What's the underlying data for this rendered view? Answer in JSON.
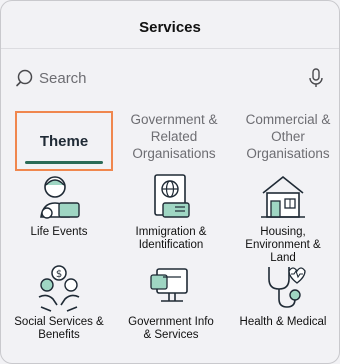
{
  "header": {
    "title": "Services"
  },
  "search": {
    "placeholder": "Search"
  },
  "tabs": [
    {
      "label": "Theme",
      "active": true
    },
    {
      "label": "Government & Related Organisations",
      "active": false
    },
    {
      "label": "Commercial & Other Organisations",
      "active": false
    }
  ],
  "tab_lines": {
    "gov": [
      "Government &",
      "Related",
      "Organisations"
    ],
    "com": [
      "Commercial &",
      "Other",
      "Organisations"
    ]
  },
  "categories": [
    {
      "icon": "life-events-icon",
      "lines": [
        "Life Events"
      ]
    },
    {
      "icon": "passport-id-icon",
      "lines": [
        "Immigration &",
        "Identification"
      ]
    },
    {
      "icon": "house-icon",
      "lines": [
        "Housing,",
        "Environment &",
        "Land"
      ]
    },
    {
      "icon": "hands-coins-icon",
      "lines": [
        "Social Services &",
        "Benefits"
      ]
    },
    {
      "icon": "computer-info-icon",
      "lines": [
        "Government Info",
        "& Services"
      ]
    },
    {
      "icon": "stethoscope-heart-icon",
      "lines": [
        "Health & Medical"
      ]
    }
  ],
  "colors": {
    "accent": "#2b6b57",
    "highlight": "#f0874e"
  }
}
